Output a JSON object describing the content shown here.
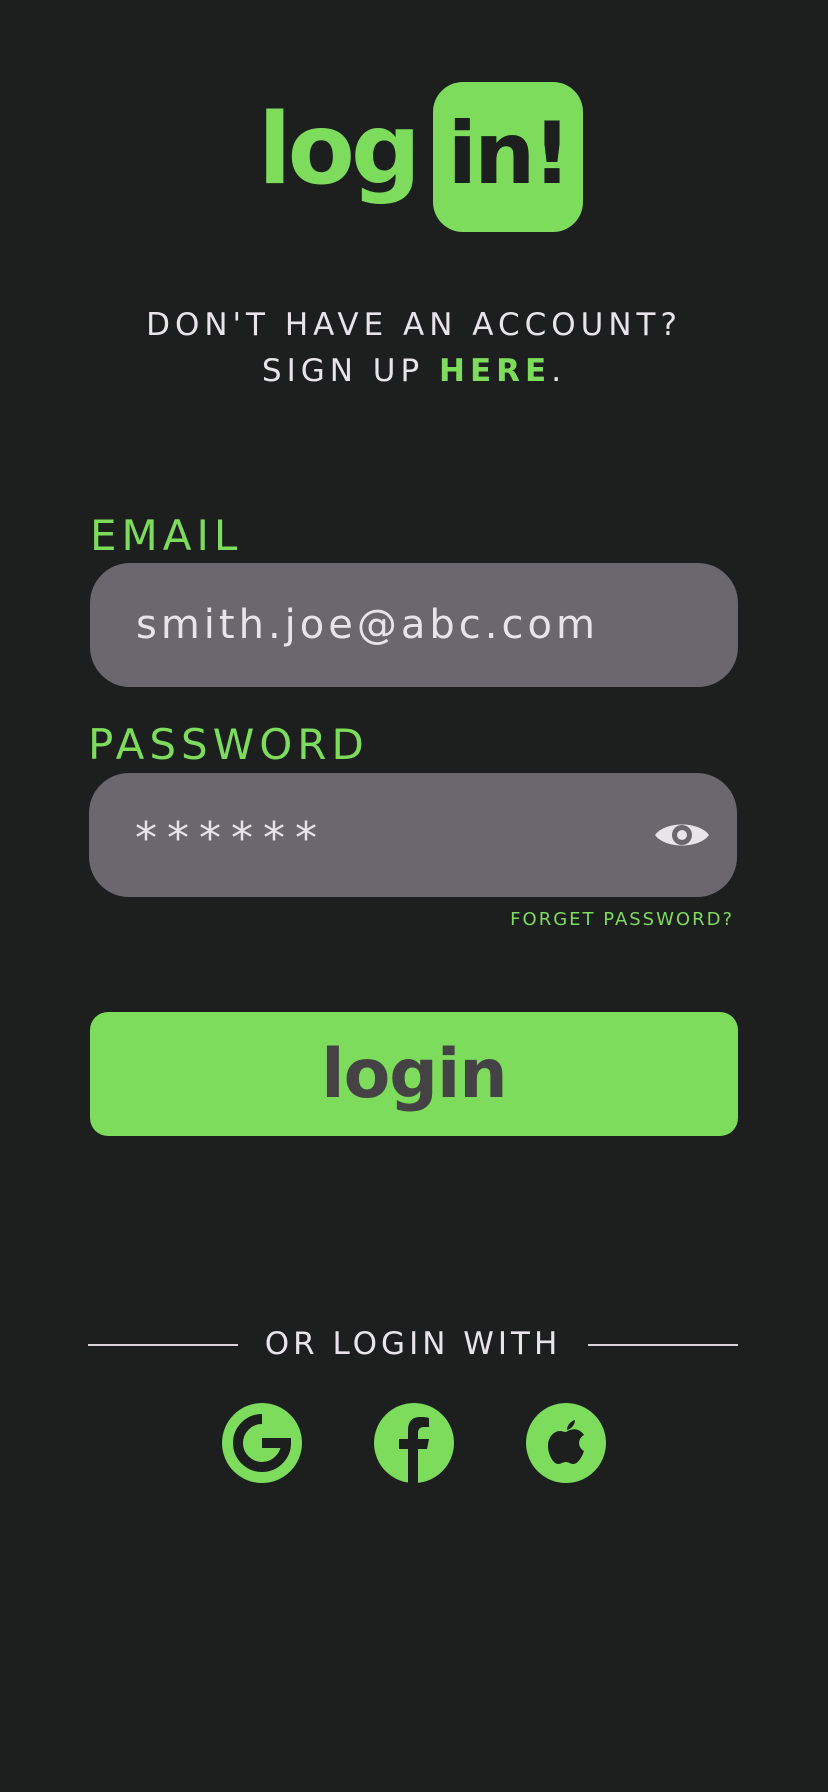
{
  "logo": {
    "word1": "log",
    "word2": "in!"
  },
  "signup": {
    "line1": "DON'T HAVE AN ACCOUNT?",
    "line2_prefix": "SIGN UP",
    "link": "HERE",
    "suffix": "."
  },
  "email": {
    "label": "EMAIL",
    "value": "smith.joe@abc.com"
  },
  "password": {
    "label": "PASSWORD",
    "value": "******",
    "toggle_icon": "eye-icon"
  },
  "forgot_password": "FORGET PASSWORD?",
  "login_button": "login",
  "social": {
    "divider_label": "OR LOGIN WITH",
    "providers": [
      {
        "name": "google",
        "icon": "google-icon"
      },
      {
        "name": "facebook",
        "icon": "facebook-icon"
      },
      {
        "name": "apple",
        "icon": "apple-icon"
      }
    ]
  },
  "colors": {
    "background": "#1c1f1e",
    "accent": "#7ddc5c",
    "field": "#6a686e",
    "text": "#e8e4ea",
    "button_text": "#444245"
  }
}
